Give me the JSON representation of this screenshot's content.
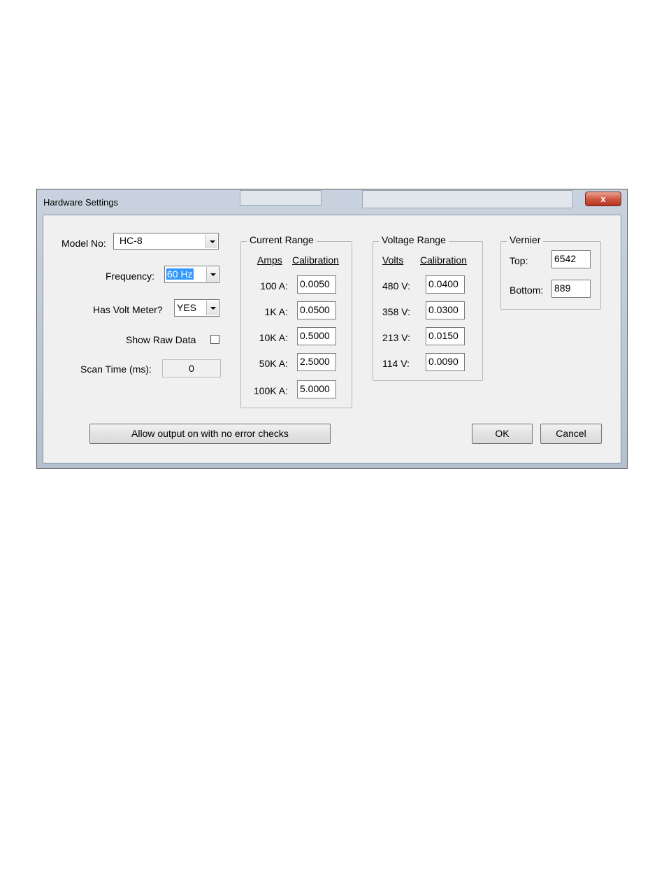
{
  "window": {
    "title": "Hardware Settings",
    "close_label": "x"
  },
  "form": {
    "model_label": "Model No:",
    "model_value": "HC-8",
    "frequency_label": "Frequency:",
    "frequency_value": "60 Hz",
    "volt_meter_label": "Has Volt Meter?",
    "volt_meter_value": "YES",
    "raw_data_label": "Show Raw Data",
    "raw_data_checked": false,
    "scan_time_label": "Scan Time (ms):",
    "scan_time_value": "0"
  },
  "current_range": {
    "title": "Current Range",
    "col_amps": "Amps",
    "col_calibration": "Calibration",
    "rows": [
      {
        "label": "100 A:",
        "value": "0.0050"
      },
      {
        "label": "1K A:",
        "value": "0.0500"
      },
      {
        "label": "10K A:",
        "value": "0.5000"
      },
      {
        "label": "50K A:",
        "value": "2.5000"
      },
      {
        "label": "100K A:",
        "value": "5.0000"
      }
    ]
  },
  "voltage_range": {
    "title": "Voltage Range",
    "col_volts": "Volts",
    "col_calibration": "Calibration",
    "rows": [
      {
        "label": "480 V:",
        "value": "0.0400"
      },
      {
        "label": "358 V:",
        "value": "0.0300"
      },
      {
        "label": "213 V:",
        "value": "0.0150"
      },
      {
        "label": "114 V:",
        "value": "0.0090"
      }
    ]
  },
  "vernier": {
    "title": "Vernier",
    "top_label": "Top:",
    "top_value": "6542",
    "bottom_label": "Bottom:",
    "bottom_value": "889"
  },
  "buttons": {
    "allow_output": "Allow output on with no error checks",
    "ok": "OK",
    "cancel": "Cancel"
  },
  "colors": {
    "selection": "#3399ff",
    "close": "#c8442f"
  }
}
